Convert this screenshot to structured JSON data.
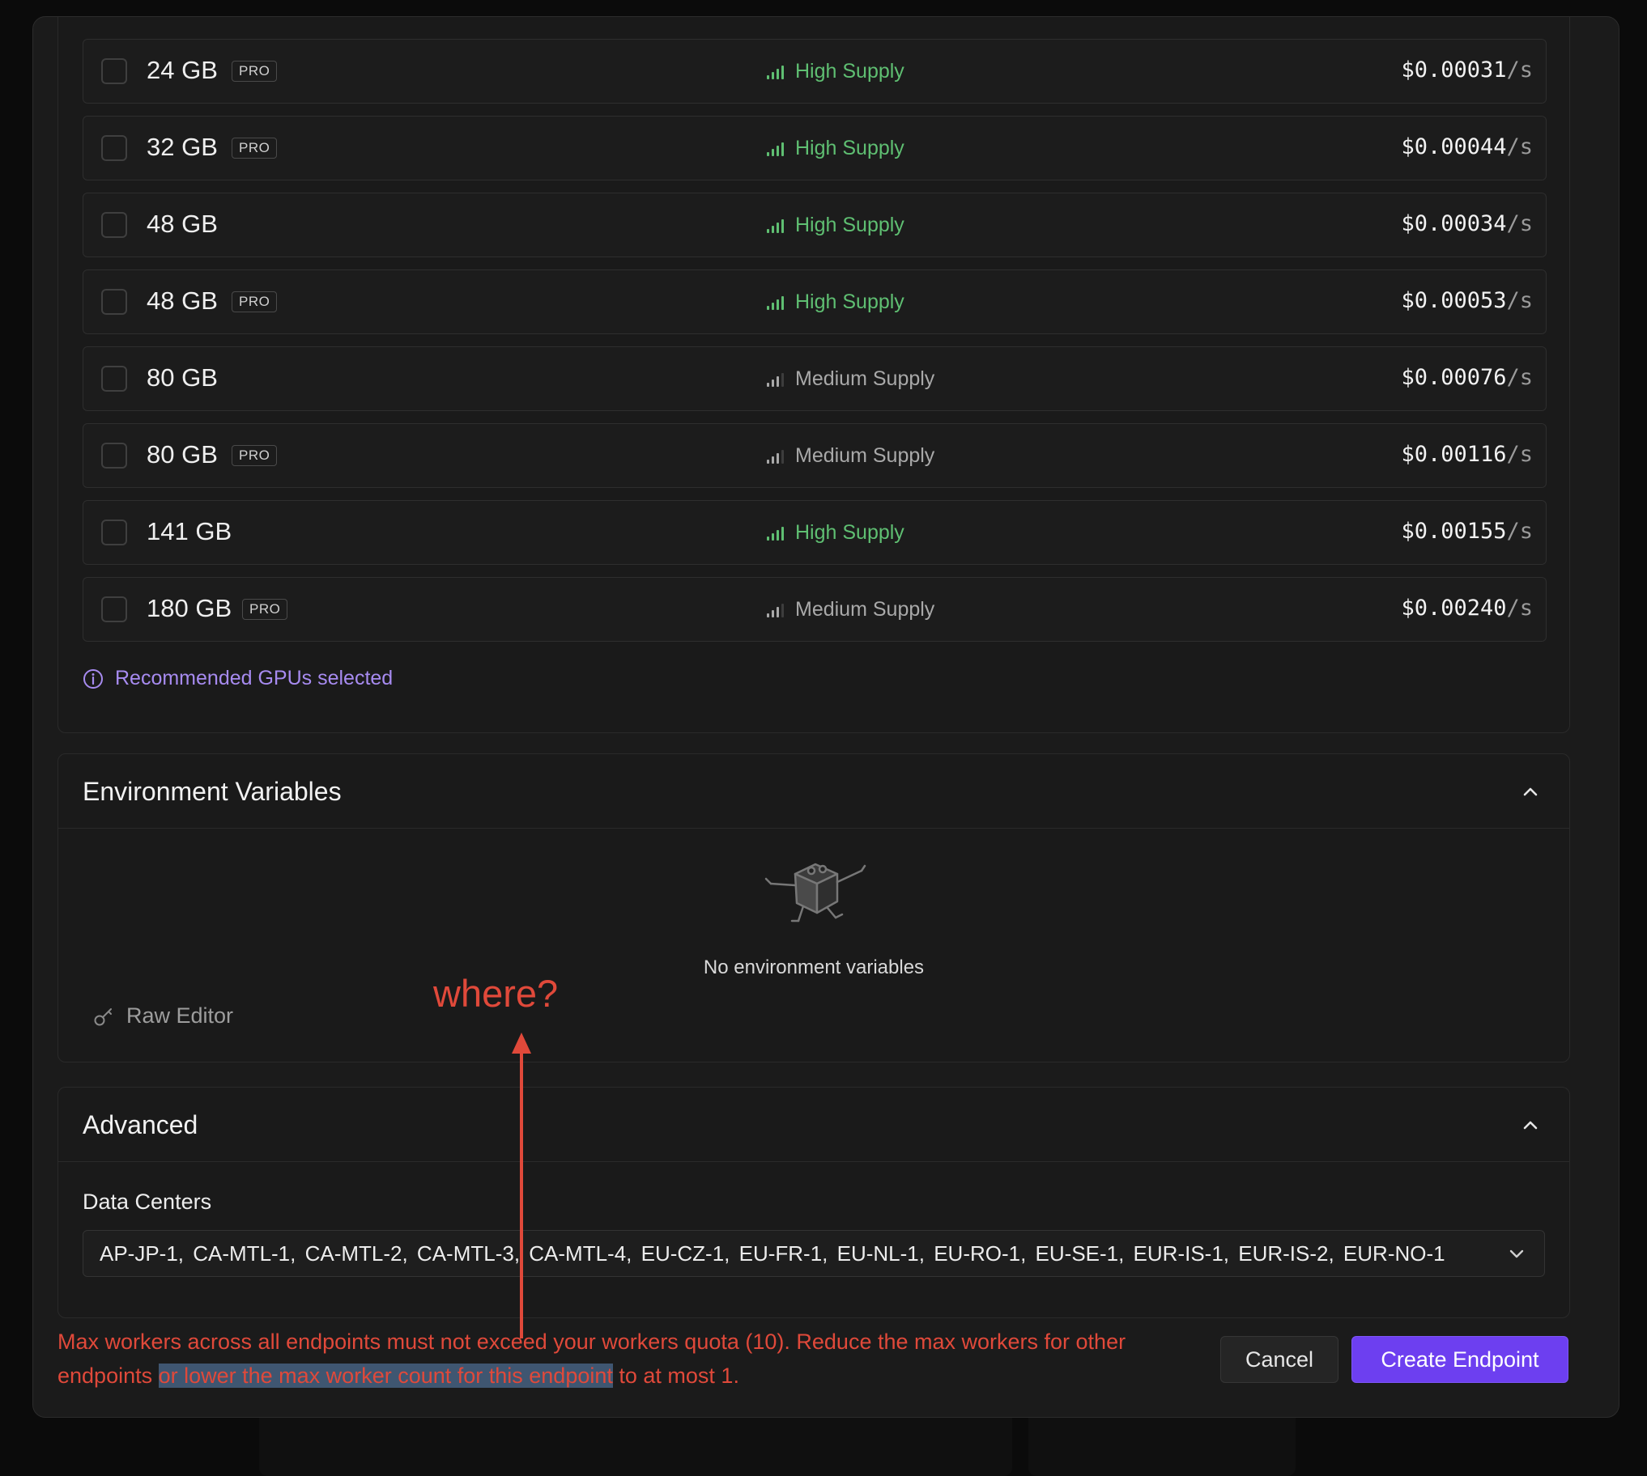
{
  "gpu_list": {
    "rows": [
      {
        "memory": "24 GB",
        "pro": "PRO",
        "supply": "High Supply",
        "supply_level": "high",
        "price": "$0.00031",
        "unit": "/s"
      },
      {
        "memory": "32 GB",
        "pro": "PRO",
        "supply": "High Supply",
        "supply_level": "high",
        "price": "$0.00044",
        "unit": "/s"
      },
      {
        "memory": "48 GB",
        "pro": "",
        "supply": "High Supply",
        "supply_level": "high",
        "price": "$0.00034",
        "unit": "/s"
      },
      {
        "memory": "48 GB",
        "pro": "PRO",
        "supply": "High Supply",
        "supply_level": "high",
        "price": "$0.00053",
        "unit": "/s"
      },
      {
        "memory": "80 GB",
        "pro": "",
        "supply": "Medium Supply",
        "supply_level": "medium",
        "price": "$0.00076",
        "unit": "/s"
      },
      {
        "memory": "80 GB",
        "pro": "PRO",
        "supply": "Medium Supply",
        "supply_level": "medium",
        "price": "$0.00116",
        "unit": "/s"
      },
      {
        "memory": "141 GB",
        "pro": "",
        "supply": "High Supply",
        "supply_level": "high",
        "price": "$0.00155",
        "unit": "/s"
      },
      {
        "memory": "180 GB",
        "pro": "PRO",
        "supply": "Medium Supply",
        "supply_level": "medium",
        "price": "$0.00240",
        "unit": "/s"
      }
    ],
    "recommendation": "Recommended GPUs selected"
  },
  "environment": {
    "title": "Environment Variables",
    "empty_text": "No environment variables",
    "raw_editor_label": "Raw Editor"
  },
  "advanced": {
    "title": "Advanced",
    "data_centers_label": "Data Centers",
    "data_centers_value": "AP-JP-1, CA-MTL-1, CA-MTL-2, CA-MTL-3, CA-MTL-4, EU-CZ-1, EU-FR-1, EU-NL-1, EU-RO-1, EU-SE-1, EUR-IS-1, EUR-IS-2, EUR-NO-1"
  },
  "footer": {
    "error_part1": "Max workers across all endpoints must not exceed your workers quota (10). Reduce the max workers for other endpoints ",
    "error_highlight": "or lower the max worker count for this endpoint",
    "error_part2": " to at most 1.",
    "cancel_label": "Cancel",
    "create_label": "Create Endpoint"
  },
  "annotation": {
    "text": "where?"
  },
  "colors": {
    "accent": "#6d3ff0",
    "high_supply": "#5fbf72",
    "medium_supply": "#a9a9a9",
    "error": "#e0493a",
    "info": "#a78bf0"
  }
}
